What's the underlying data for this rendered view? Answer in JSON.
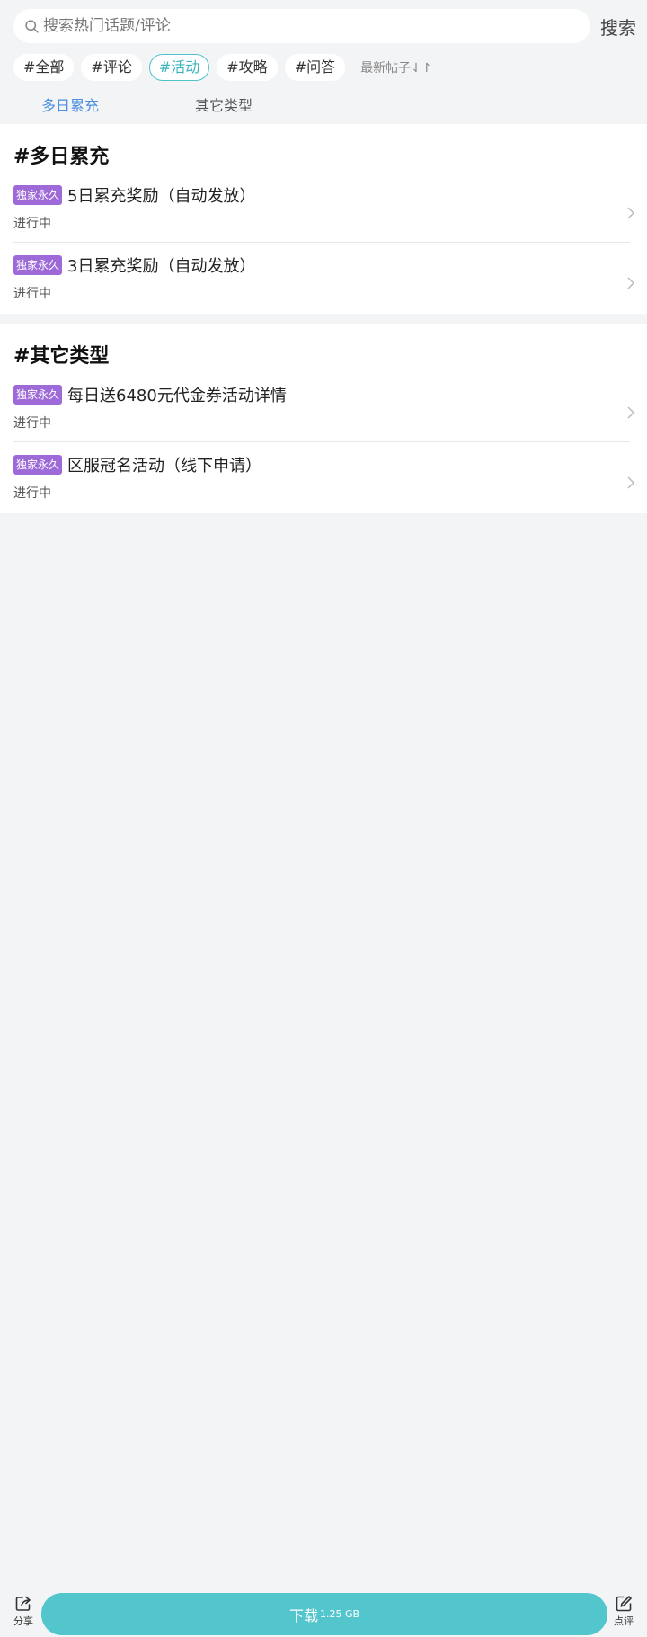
{
  "search": {
    "placeholder": "搜索热门话题/评论",
    "button_label": "搜索"
  },
  "tags": [
    {
      "label": "#全部",
      "active": false
    },
    {
      "label": "#评论",
      "active": false
    },
    {
      "label": "#活动",
      "active": true
    },
    {
      "label": "#攻略",
      "active": false
    },
    {
      "label": "#问答",
      "active": false
    }
  ],
  "sort_label": "最新帖子⇃↾",
  "subtabs": [
    {
      "label": "多日累充",
      "active": true
    },
    {
      "label": "其它类型",
      "active": false
    }
  ],
  "sections": [
    {
      "title": "#多日累充",
      "items": [
        {
          "badge": "独家永久",
          "title": "5日累充奖励（自动发放）",
          "status": "进行中"
        },
        {
          "badge": "独家永久",
          "title": "3日累充奖励（自动发放）",
          "status": "进行中"
        }
      ]
    },
    {
      "title": "#其它类型",
      "items": [
        {
          "badge": "独家永久",
          "title": "每日送6480元代金券活动详情",
          "status": "进行中"
        },
        {
          "badge": "独家永久",
          "title": "区服冠名活动（线下申请）",
          "status": "进行中"
        }
      ]
    }
  ],
  "bottom_bar": {
    "share_label": "分享",
    "download_label": "下载",
    "download_size": "1.25 GB",
    "review_label": "点评"
  },
  "colors": {
    "accent": "#53c5cc",
    "active_tag_border": "#4fc2cb",
    "subtab_active": "#4a8fe0",
    "badge": "#9d6ad8",
    "background": "#f3f4f6"
  },
  "icons": [
    "search-icon",
    "chevron-right-icon",
    "share-icon",
    "edit-icon"
  ]
}
